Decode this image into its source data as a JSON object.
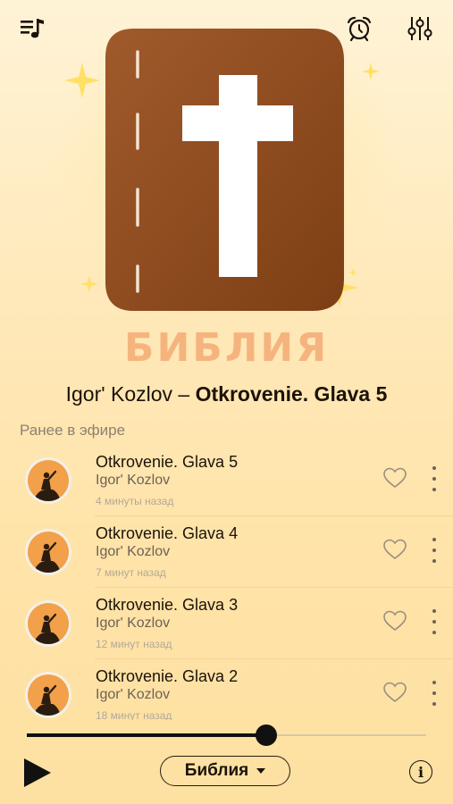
{
  "app": {
    "logo_text": "БИБЛИЯ",
    "accent_color": "#f5b27c",
    "icons": {
      "top_left": "playlist-music-icon",
      "top_right_1": "alarm-clock-icon",
      "top_right_2": "equalizer-sliders-icon",
      "artwork": "bible-book-cross-icon"
    }
  },
  "now_playing": {
    "artist": "Igor' Kozlov",
    "separator": " – ",
    "title": "Otkrovenie. Glava 5"
  },
  "history": {
    "label": "Ранее в эфире",
    "items": [
      {
        "title": "Otkrovenie. Glava 5",
        "artist": "Igor' Kozlov",
        "time": "4 минуты назад"
      },
      {
        "title": "Otkrovenie. Glava 4",
        "artist": "Igor' Kozlov",
        "time": "7 минут назад"
      },
      {
        "title": "Otkrovenie. Glava 3",
        "artist": "Igor' Kozlov",
        "time": "12 минут назад"
      },
      {
        "title": "Otkrovenie. Glava 2",
        "artist": "Igor' Kozlov",
        "time": "18 минут назад"
      }
    ]
  },
  "player": {
    "progress_fraction": 0.6,
    "station": "Библия",
    "play_icon": "play-icon",
    "info_symbol": "i"
  }
}
